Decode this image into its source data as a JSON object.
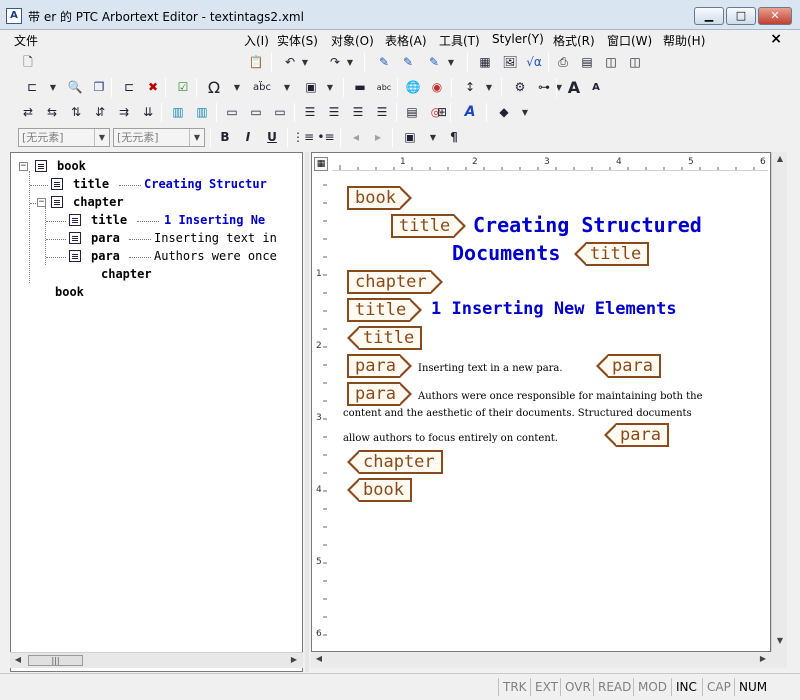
{
  "window": {
    "title": "带        er 的 PTC Arbortext Editor - textintags2.xml",
    "icon_text": "A"
  },
  "menu": {
    "items": [
      "文件",
      "入(I)",
      "实体(S)",
      "对象(O)",
      "表格(A)",
      "工具(T)",
      "Styler(Y)",
      "格式(R)",
      "窗口(W)",
      "帮助(H)"
    ],
    "close": "×"
  },
  "toolbar3": {
    "special_char": "Ω",
    "spell": "ab̈c",
    "font_bigger": "A",
    "font_smaller": "A",
    "link": "⟲"
  },
  "toolbar4": {
    "combo1": "[无元素]",
    "combo2": "[无元素]",
    "bold": "B",
    "italic": "I",
    "underline": "U",
    "pilcrow": "¶"
  },
  "tree": {
    "nodes": [
      {
        "name": "book",
        "preview": ""
      },
      {
        "name": "title",
        "preview": "Creating Structur"
      },
      {
        "name": "chapter",
        "preview": ""
      },
      {
        "name": "title",
        "preview": "1 Inserting Ne"
      },
      {
        "name": "para",
        "preview": "Inserting text in"
      },
      {
        "name": "para",
        "preview": "Authors were once"
      },
      {
        "name": "chapter",
        "preview": ""
      },
      {
        "name": "book",
        "preview": ""
      }
    ]
  },
  "ruler": {
    "h_ticks": [
      "1",
      "2",
      "3",
      "4",
      "5",
      "6"
    ],
    "v_ticks": [
      "1",
      "2",
      "3",
      "4",
      "5",
      "6"
    ]
  },
  "doc": {
    "tag_book": "book",
    "tag_title": "title",
    "tag_chapter": "chapter",
    "tag_para": "para",
    "heading_line1": "Creating Structured",
    "heading_line2": "Documents",
    "section_heading": "1 Inserting New Elements",
    "para1": "Inserting text in a new para.",
    "para2_line1": "Authors were once responsible for maintaining both the",
    "para2_line2": "content and the aesthetic of their documents. Structured documents",
    "para2_line3": "allow authors to focus entirely on content."
  },
  "statusbar": {
    "items": [
      "TRK",
      "EXT",
      "OVR",
      "READ",
      "MOD",
      "INC",
      "CAP",
      "NUM"
    ],
    "active": [
      "INC",
      "NUM"
    ]
  },
  "colors": {
    "heading": "#0000cc",
    "tag": "#8a4a1a"
  }
}
